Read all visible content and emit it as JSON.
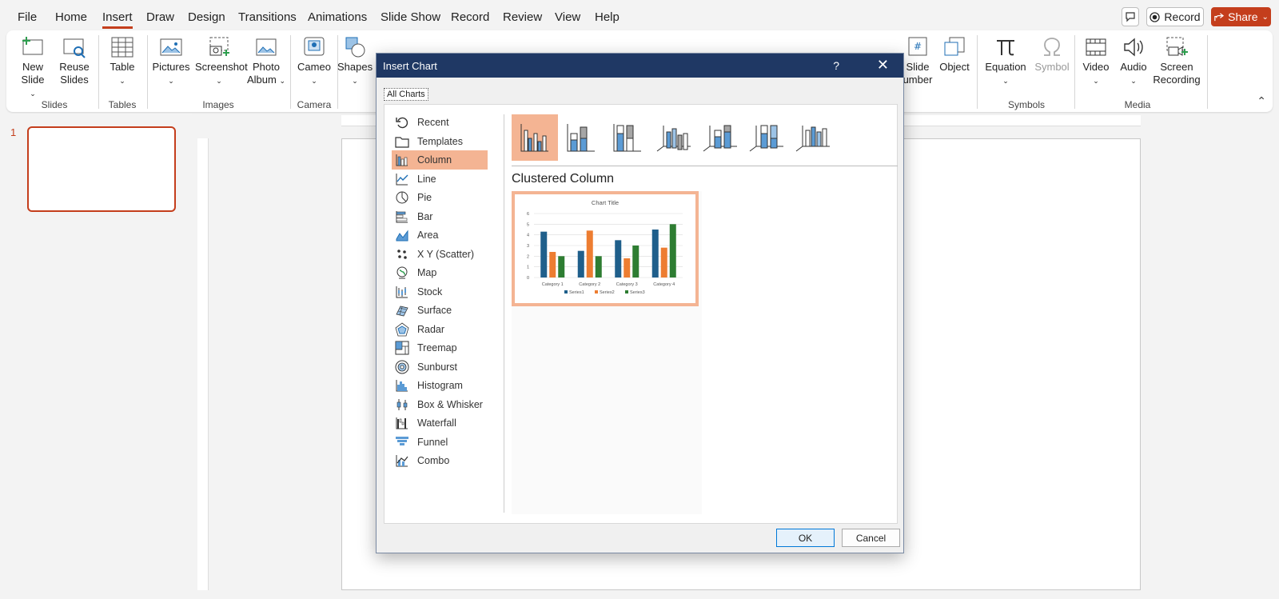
{
  "menubar": {
    "tabs": [
      "File",
      "Home",
      "Insert",
      "Draw",
      "Design",
      "Transitions",
      "Animations",
      "Slide Show",
      "Record",
      "Review",
      "View",
      "Help"
    ],
    "active_tab": "Insert",
    "record_label": "Record",
    "share_label": "Share"
  },
  "ribbon": {
    "new_slide": "New Slide",
    "reuse_slides": "Reuse Slides",
    "table": "Table",
    "pictures": "Pictures",
    "screenshot": "Screenshot",
    "photo_album": "Photo Album",
    "cameo": "Cameo",
    "shapes": "Shapes",
    "slide_number": "umber",
    "slide_number_top": "Slide",
    "object": "Object",
    "equation": "Equation",
    "symbol": "Symbol",
    "video": "Video",
    "audio": "Audio",
    "screen_recording": "Screen Recording",
    "groups": {
      "slides": "Slides",
      "tables": "Tables",
      "images": "Images",
      "camera": "Camera",
      "symbols": "Symbols",
      "media": "Media"
    }
  },
  "slides_pane": {
    "slide_number": "1"
  },
  "dialog": {
    "title": "Insert Chart",
    "help": "?",
    "close": "✕",
    "tab": "All Charts",
    "categories": [
      "Recent",
      "Templates",
      "Column",
      "Line",
      "Pie",
      "Bar",
      "Area",
      "X Y (Scatter)",
      "Map",
      "Stock",
      "Surface",
      "Radar",
      "Treemap",
      "Sunburst",
      "Histogram",
      "Box & Whisker",
      "Waterfall",
      "Funnel",
      "Combo"
    ],
    "selected_category": "Column",
    "selected_type_title": "Clustered Column",
    "ok_label": "OK",
    "cancel_label": "Cancel"
  },
  "chart_data": {
    "type": "bar",
    "title": "Chart Title",
    "categories": [
      "Category 1",
      "Category 2",
      "Category 3",
      "Category 4"
    ],
    "series": [
      {
        "name": "Series1",
        "values": [
          4.3,
          2.5,
          3.5,
          4.5
        ],
        "color": "#1f5f8b"
      },
      {
        "name": "Series2",
        "values": [
          2.4,
          4.4,
          1.8,
          2.8
        ],
        "color": "#ed7d31"
      },
      {
        "name": "Series3",
        "values": [
          2,
          2,
          3,
          5
        ],
        "color": "#2e7d32"
      }
    ],
    "ylim": [
      0,
      6
    ],
    "yticks": [
      0,
      1,
      2,
      3,
      4,
      5,
      6
    ],
    "legend": "bottom",
    "grid": true
  },
  "colors": {
    "accent": "#c43e1c",
    "dialog_title_bar": "#1f3864",
    "selection": "#f4b493"
  }
}
